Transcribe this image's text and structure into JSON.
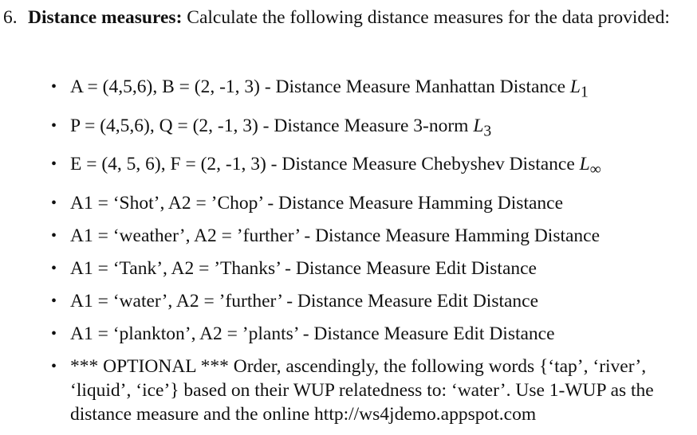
{
  "question": {
    "number": "6.",
    "title": "Distance measures:",
    "intro": " Calculate the following distance measures for the data provided:"
  },
  "items": [
    {
      "text": "A = (4,5,6), B = (2, -1, 3) - Distance Measure Manhattan Distance ",
      "math": "L",
      "sub": "1"
    },
    {
      "text": "P = (4,5,6), Q = (2, -1, 3) - Distance Measure 3-norm ",
      "math": "L",
      "sub": "3"
    },
    {
      "text": "E = (4, 5, 6), F = (2, -1, 3) - Distance Measure Chebyshev Distance ",
      "math": "L",
      "sub": "∞"
    },
    {
      "text": "A1 = ‘Shot’, A2 = ’Chop’ - Distance Measure Hamming Distance"
    },
    {
      "text": "A1 = ‘weather’, A2 = ’further’ - Distance Measure Hamming Distance"
    },
    {
      "text": "A1 = ‘Tank’, A2 = ’Thanks’ - Distance Measure Edit Distance"
    },
    {
      "text": "A1 = ‘water’, A2 = ’further’ - Distance Measure Edit Distance"
    },
    {
      "text": "A1 = ‘plankton’, A2 = ’plants’ - Distance Measure Edit Distance"
    },
    {
      "text": "*** OPTIONAL *** Order, ascendingly, the following words {‘tap’, ‘river’, ‘liquid’, ‘ice’} based on their WUP relatedness to: ‘water’. Use 1-WUP as the distance measure and the online http://ws4jdemo.appspot.com"
    }
  ],
  "bullet_symbol": "•"
}
